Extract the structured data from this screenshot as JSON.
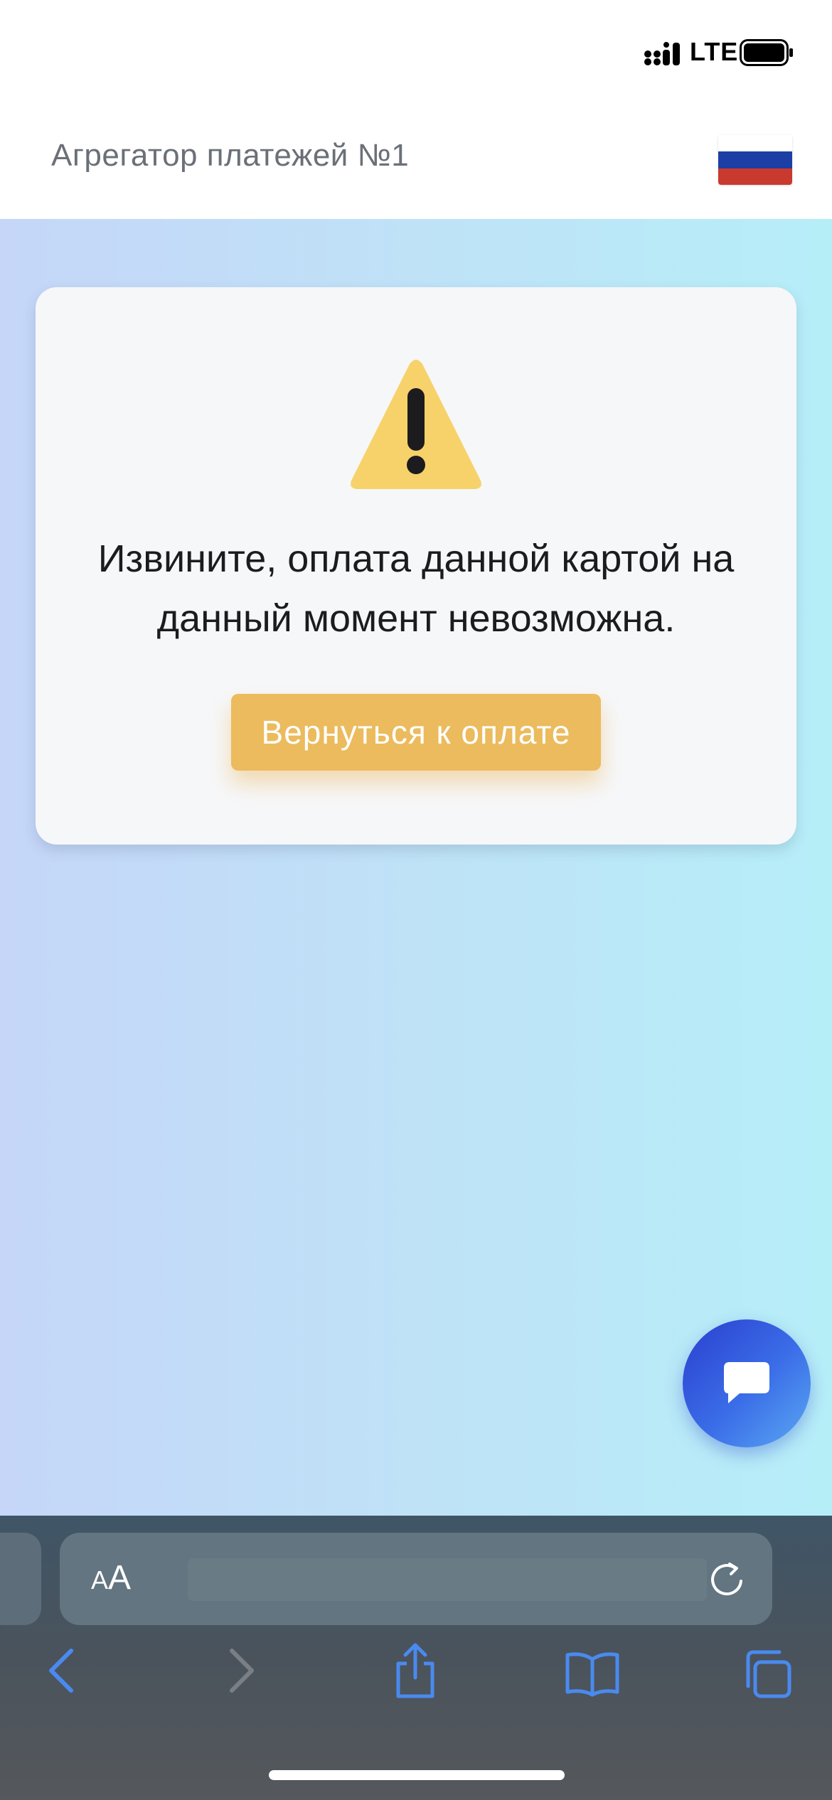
{
  "status_bar": {
    "network": "LTE",
    "icons": [
      "signal-icon",
      "battery-icon"
    ]
  },
  "header": {
    "title": "Агрегатор платежей №1",
    "flag_icon": "russia-flag-icon",
    "flag_colors": [
      "#ffffff",
      "#1c3fa6",
      "#c9392e"
    ]
  },
  "error_card": {
    "icon": "warning-icon",
    "message_line1": "Извините, оплата данной картой на",
    "message_line2": "данный момент невозможна.",
    "button_label": "Вернуться к оплате"
  },
  "chat": {
    "icon": "chat-bubble-icon"
  },
  "browser": {
    "aa_small": "A",
    "aa_big": "A",
    "icons": [
      "reload-icon",
      "back-icon",
      "forward-icon",
      "share-icon",
      "bookmarks-icon",
      "tabs-icon"
    ]
  },
  "colors": {
    "accent_button": "#ebbb5e",
    "warning_yellow": "#f7d26a",
    "chat_blue": "#2a3fcf"
  }
}
